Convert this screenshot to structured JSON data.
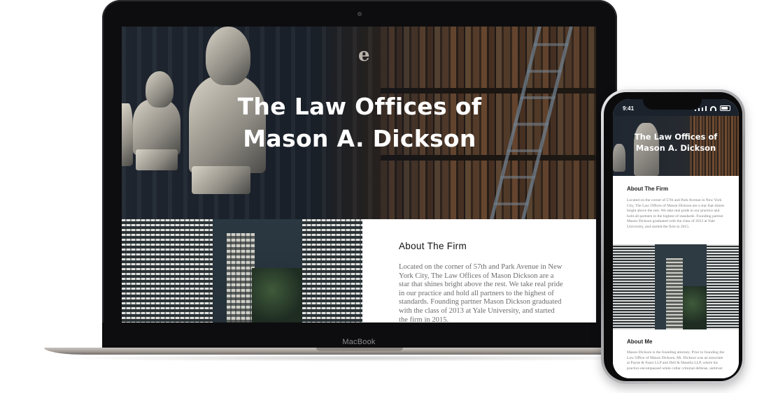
{
  "laptop": {
    "brand_label": "MacBook",
    "hero": {
      "decor_letter": "e",
      "title_line1": "The Law Offices of",
      "title_line2": "Mason A. Dickson"
    },
    "about": {
      "heading": "About The Firm",
      "body": "Located on the corner of 57th and Park Avenue in New York City, The Law Offices of Mason Dickson are a star that shines bright above the rest. We take real pride in our practice and hold all partners to the highest of standards. Founding partner Mason Dickson graduated with the class of 2013 at Yale University, and started the firm in 2015."
    }
  },
  "phone": {
    "status_time": "9:41",
    "hero": {
      "title_line1": "The Law Offices of",
      "title_line2": "Mason A. Dickson"
    },
    "about": {
      "heading": "About The Firm",
      "body": "Located on the corner of 57th and Park Avenue in New York City, The Law Offices of Mason Dickson are a star that shines bright above the rest. We take real pride in our practice and hold all partners to the highest of standards. Founding partner Mason Dickson graduated with the class of 2013 at Yale University, and started the firm in 2015."
    },
    "about_me": {
      "heading": "About Me",
      "body": "Mason Dickson is the founding attorney. Prior to founding the Law Office of Mason Dickson, Mr. Dickson was an associate at Payne & Fears LLP and Dell & Masella LLP, where his practice encompassed white collar criminal defense, antitrust"
    }
  }
}
